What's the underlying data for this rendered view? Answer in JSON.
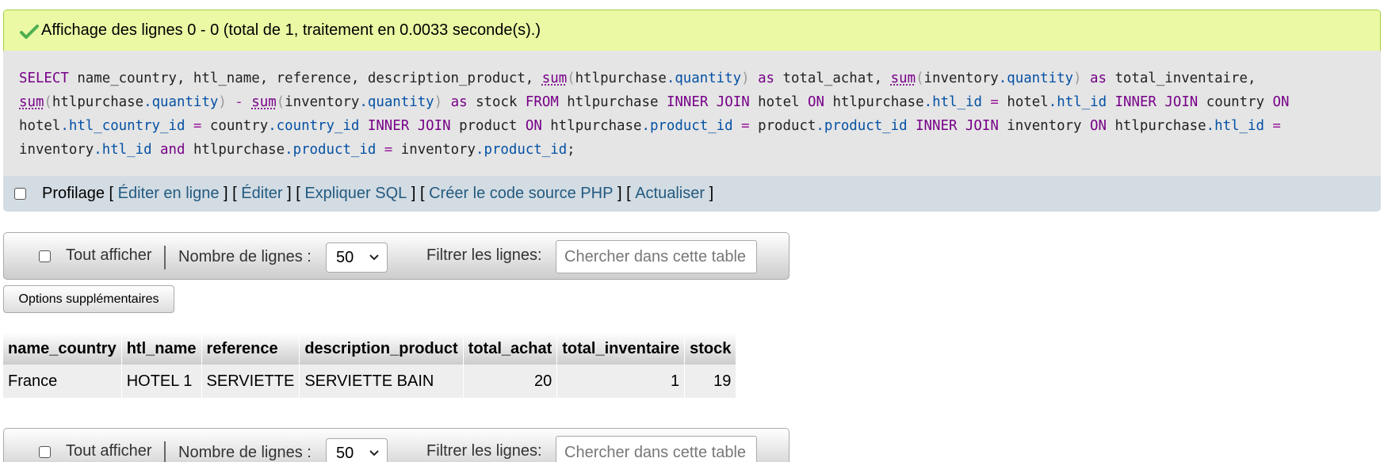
{
  "success": {
    "icon": "check-icon",
    "message": "Affichage des lignes 0 - 0 (total de 1, traitement en 0.0033 seconde(s).)"
  },
  "sql": {
    "query": "SELECT name_country, htl_name, reference, description_product, sum(htlpurchase.quantity) as total_achat, sum(inventory.quantity) as total_inventaire, sum(htlpurchase.quantity) - sum(inventory.quantity) as stock FROM htlpurchase INNER JOIN hotel ON htlpurchase.htl_id = hotel.htl_id INNER JOIN country ON hotel.htl_country_id = country.country_id INNER JOIN product ON htlpurchase.product_id = product.product_id INNER JOIN inventory ON htlpurchase.htl_id = inventory.htl_id and htlpurchase.product_id = inventory.product_id;"
  },
  "profiling": {
    "label": "Profilage",
    "links": [
      "Éditer en ligne",
      "Éditer",
      "Expliquer SQL",
      "Créer le code source PHP",
      "Actualiser"
    ]
  },
  "nav": {
    "show_all": "Tout afficher",
    "rows_label": "Nombre de lignes :",
    "rows_value": "50",
    "filter_label": "Filtrer les lignes:",
    "filter_placeholder": "Chercher dans cette table"
  },
  "options_button": "Options supplémentaires",
  "table": {
    "columns": [
      "name_country",
      "htl_name",
      "reference",
      "description_product",
      "total_achat",
      "total_inventaire",
      "stock"
    ],
    "rows": [
      [
        "France",
        "HOTEL 1",
        "SERVIETTE",
        "SERVIETTE BAIN",
        "20",
        "1",
        "19"
      ]
    ]
  },
  "colors": {
    "success_bg": "#ebf8a4",
    "sql_bg": "#e5e5e5",
    "profiling_bg": "#d3dce3",
    "link": "#235a81",
    "check": "#4caf50"
  }
}
